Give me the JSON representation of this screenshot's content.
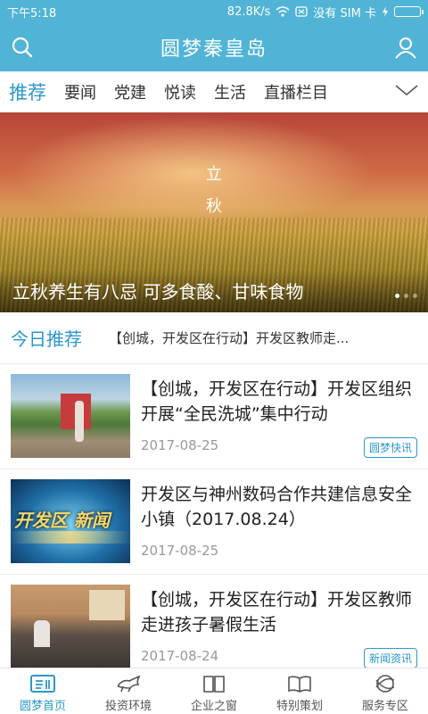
{
  "status_bar": {
    "time": "下午5:18",
    "net_speed": "82.8K/s",
    "carrier": "没有 SIM 卡"
  },
  "header": {
    "title": "圆梦秦皇岛",
    "search_icon": "search-icon",
    "user_icon": "user-icon"
  },
  "tabs": {
    "items": [
      {
        "label": "推荐",
        "active": true
      },
      {
        "label": "要闻"
      },
      {
        "label": "党建"
      },
      {
        "label": "悦读"
      },
      {
        "label": "生活"
      },
      {
        "label": "直播栏目"
      }
    ],
    "more_icon": "chevron-down-icon"
  },
  "banner": {
    "vertical_text": [
      "立",
      "秋"
    ],
    "caption": "立秋养生有八忌 可多食酸、甘味食物",
    "dot_count": 3,
    "active_dot": 0
  },
  "today": {
    "label": "今日推荐",
    "ticker": "【创城，开发区在行动】开发区教师走..."
  },
  "news": [
    {
      "title": "【创城，开发区在行动】开发区组织开展“全民洗城”集中行动",
      "date": "2017-08-25",
      "tag": "圆梦快讯"
    },
    {
      "title": "开发区与神州数码合作共建信息安全小镇（2017.08.24）",
      "date": "2017-08-25",
      "tag": ""
    },
    {
      "title": "【创城，开发区在行动】开发区教师走进孩子暑假生活",
      "date": "2017-08-24",
      "tag": "新闻资讯"
    }
  ],
  "thumb_text": {
    "news2": "开发区 新闻"
  },
  "bottom_nav": [
    {
      "label": "圆梦首页",
      "icon": "home-icon",
      "active": true
    },
    {
      "label": "投资环境",
      "icon": "horse-icon"
    },
    {
      "label": "企业之窗",
      "icon": "book-icon"
    },
    {
      "label": "特别策划",
      "icon": "open-book-icon"
    },
    {
      "label": "服务专区",
      "icon": "globe-icon"
    }
  ],
  "colors": {
    "primary": "#51b4d6",
    "accent": "#2c97c9"
  }
}
